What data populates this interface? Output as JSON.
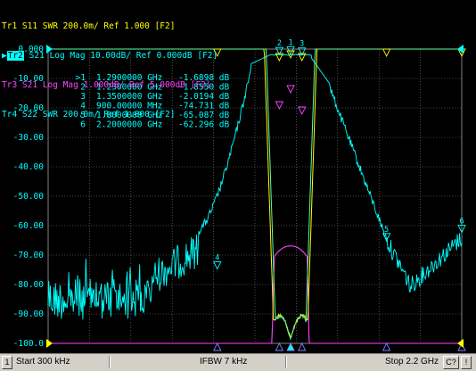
{
  "traces": [
    {
      "id": "Tr1",
      "text": "Tr1 S11 SWR 200.0m/ Ref 1.000 [F2]",
      "color": "#ffff00",
      "active": false
    },
    {
      "id": "Tr2",
      "text": "Tr2 S21 Log Mag 10.00dB/ Ref 0.000dB [F2]",
      "color": "#00ffff",
      "active": true
    },
    {
      "id": "Tr3",
      "text": "Tr3 S21 Log Mag 1.000dB/ Ref 5.000dB [F2]",
      "color": "#ff44ff",
      "active": false
    },
    {
      "id": "Tr4",
      "text": "Tr4 S22 SWR 200.0m/ Ref 1.000 [F2]",
      "color": "#00ffff",
      "active": false
    }
  ],
  "y_ticks": [
    "0.000",
    "-10.00",
    "-20.00",
    "-30.00",
    "-40.00",
    "-50.00",
    "-60.00",
    "-70.00",
    "-80.00",
    "-90.00",
    "-100.0"
  ],
  "marker_table": [
    {
      "prefix": ">1",
      "freq": "1.2900000 GHz",
      "value": "-1.6898 dB"
    },
    {
      "prefix": "2",
      "freq": "1.2300000 GHz",
      "value": "-1.8550 dB"
    },
    {
      "prefix": "3",
      "freq": "1.3500000 GHz",
      "value": "-2.0194 dB"
    },
    {
      "prefix": "4",
      "freq": "900.00000 MHz",
      "value": "-74.731 dB"
    },
    {
      "prefix": "5",
      "freq": "1.8000000 GHz",
      "value": "-65.087 dB"
    },
    {
      "prefix": "6",
      "freq": "2.2000000 GHz",
      "value": "-62.296 dB"
    }
  ],
  "status": {
    "channel": "1",
    "start": "Start 300 kHz",
    "ifbw": "IFBW 7 kHz",
    "stop": "Stop 2.2 GHz",
    "cal": "C?",
    "flag": "!"
  },
  "axis": {
    "x_start_ghz": 0.0003,
    "x_stop_ghz": 2.2,
    "y_top_db": 0,
    "y_bottom_db": -100
  },
  "marker_names": [
    "1",
    "2",
    "3",
    "4",
    "5",
    "6"
  ],
  "colors": {
    "cyan": "#00ffff",
    "yellow": "#ffff00",
    "magenta": "#ff44ff",
    "grid": "#808080",
    "background": "#000000"
  }
}
